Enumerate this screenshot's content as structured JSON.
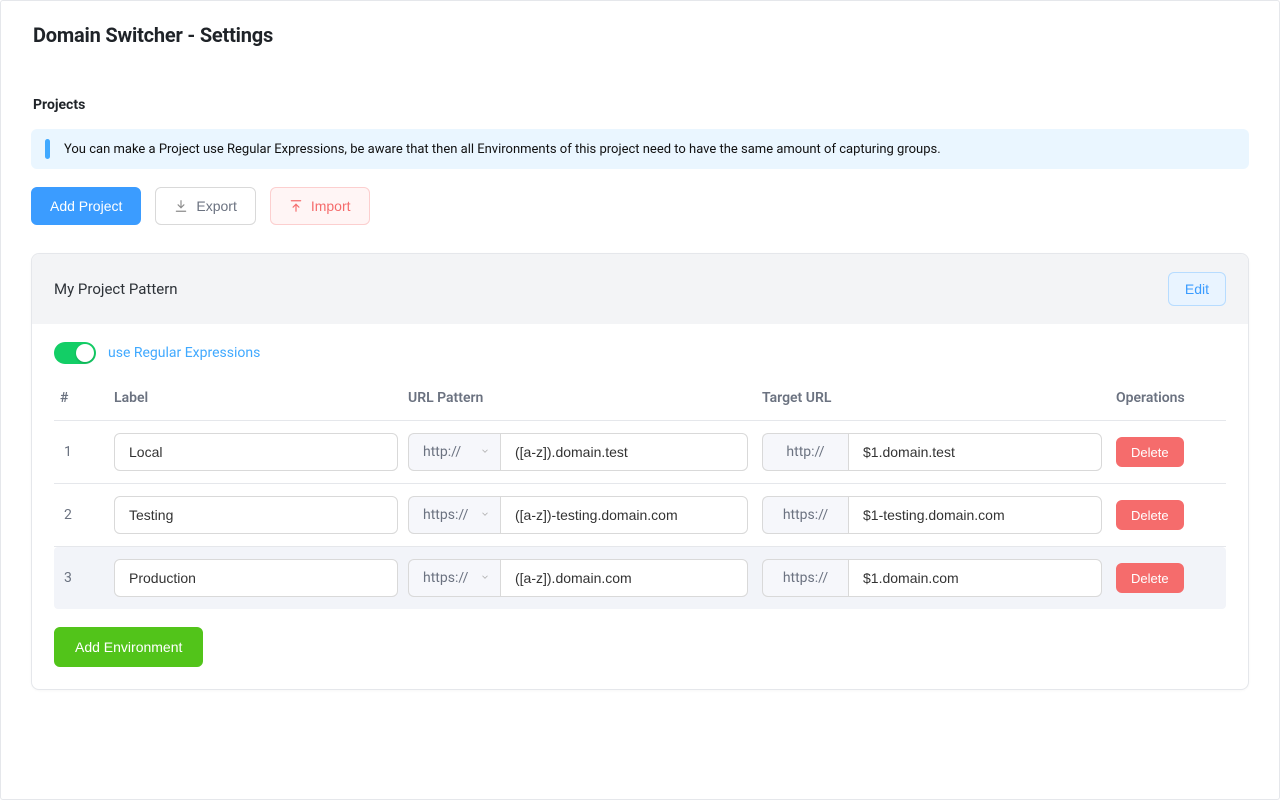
{
  "page": {
    "title": "Domain Switcher - Settings"
  },
  "section": {
    "heading": "Projects",
    "alert": "You can make a Project use Regular Expressions, be aware that then all Environments of this project need to have the same amount of capturing groups."
  },
  "toolbar": {
    "add_project": "Add Project",
    "export": "Export",
    "import": "Import"
  },
  "project": {
    "title": "My Project Pattern",
    "edit_label": "Edit",
    "regex_toggle_label": "use Regular Expressions",
    "regex_enabled": true,
    "columns": {
      "index": "#",
      "label": "Label",
      "url_pattern": "URL Pattern",
      "target_url": "Target URL",
      "operations": "Operations"
    },
    "delete_label": "Delete",
    "add_env_label": "Add Environment",
    "rows": [
      {
        "index": "1",
        "label": "Local",
        "pattern_scheme": "http://",
        "pattern_value": "([a-z]).domain.test",
        "target_scheme": "http://",
        "target_value": "$1.domain.test"
      },
      {
        "index": "2",
        "label": "Testing",
        "pattern_scheme": "https://",
        "pattern_value": "([a-z])-testing.domain.com",
        "target_scheme": "https://",
        "target_value": "$1-testing.domain.com"
      },
      {
        "index": "3",
        "label": "Production",
        "pattern_scheme": "https://",
        "pattern_value": "([a-z]).domain.com",
        "target_scheme": "https://",
        "target_value": "$1.domain.com"
      }
    ]
  }
}
